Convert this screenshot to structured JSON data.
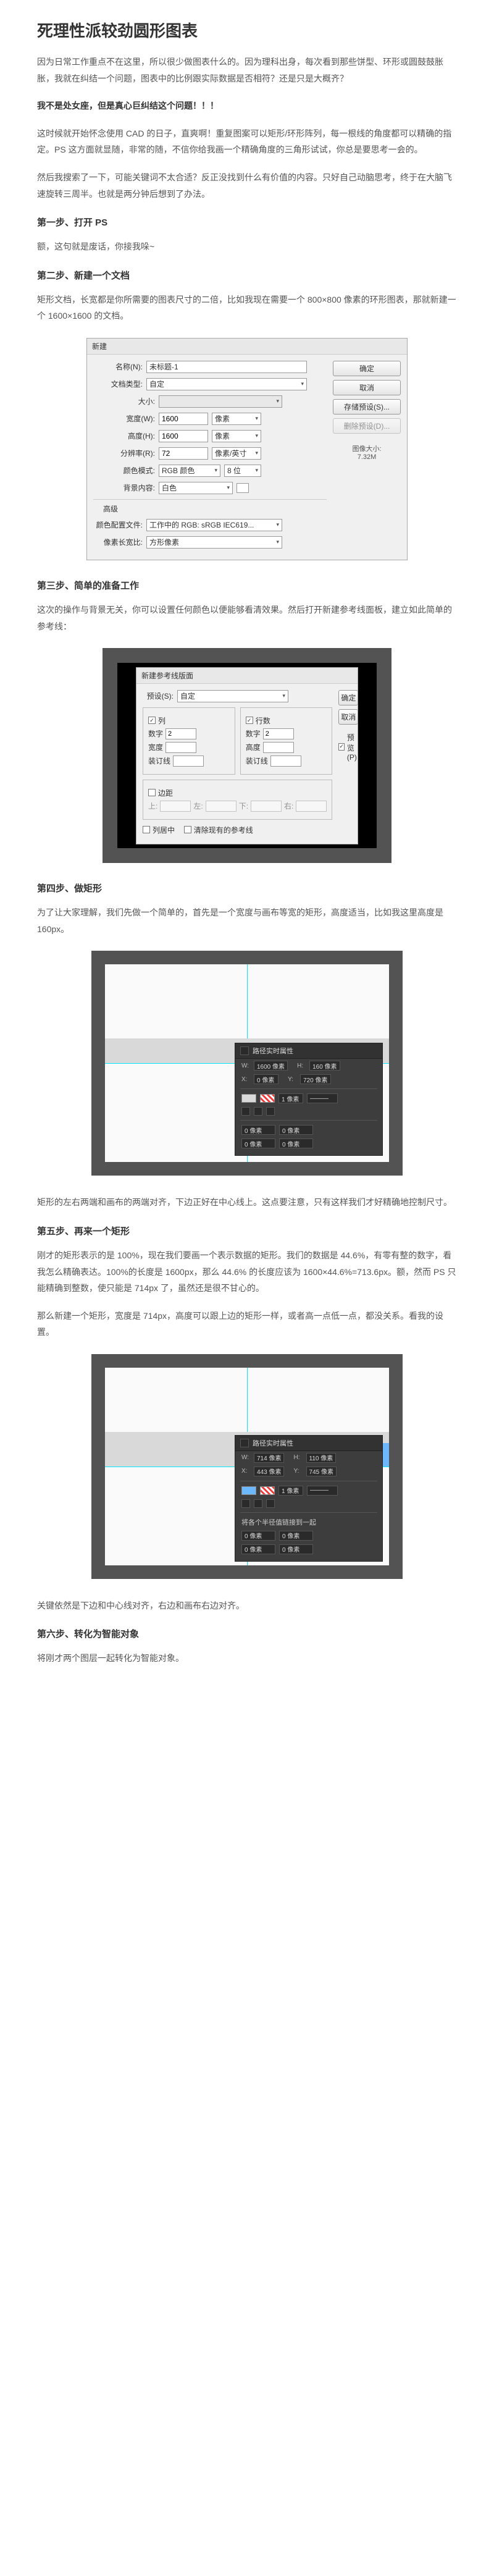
{
  "title": "死理性派较劲圆形图表",
  "intro1": "因为日常工作重点不在这里，所以很少做图表什么的。因为理科出身，每次看到那些饼型、环形或圆鼓鼓胀胀，我就在纠结一个问题，图表中的比例跟实际数据是否相符？还是只是大概齐？",
  "intro2_bold": "我不是处女座，但是真心巨纠结这个问题！！！",
  "intro3": "这时候就开始怀念使用 CAD 的日子，直爽啊！重复图案可以矩形/环形阵列，每一根线的角度都可以精确的指定。PS 这方面就显随，非常的随，不信你给我画一个精确角度的三角形试试，你总是要思考一会的。",
  "intro4": "然后我搜索了一下，可能关键词不太合适？反正没找到什么有价值的内容。只好自己动脑思考，终于在大脑飞速旋转三周半。也就是两分钟后想到了办法。",
  "step1_title": "第一步、打开 PS",
  "step1_text": "额，这句就是废话，你接我哚~",
  "step2_title": "第二步、新建一个文档",
  "step2_text": "矩形文档，长宽都是你所需要的图表尺寸的二倍，比如我现在需要一个 800×800 像素的环形图表，那就新建一个 1600×1600 的文档。",
  "newdoc": {
    "dlg_title": "新建",
    "name_lbl": "名称(N):",
    "name_val": "未标题-1",
    "preset_lbl": "文档类型:",
    "preset_val": "自定",
    "size_lbl": "大小:",
    "width_lbl": "宽度(W):",
    "width_val": "1600",
    "unit": "像素",
    "height_lbl": "高度(H):",
    "height_val": "1600",
    "res_lbl": "分辨率(R):",
    "res_val": "72",
    "res_unit": "像素/英寸",
    "mode_lbl": "颜色模式:",
    "mode_val": "RGB 颜色",
    "mode_bits": "8 位",
    "bg_lbl": "背景内容:",
    "bg_val": "白色",
    "adv_lbl": "高级",
    "profile_lbl": "颜色配置文件:",
    "profile_val": "工作中的 RGB: sRGB IEC619...",
    "aspect_lbl": "像素长宽比:",
    "aspect_val": "方形像素",
    "ok": "确定",
    "cancel": "取消",
    "save_preset": "存储预设(S)...",
    "del_preset": "删除预设(D)...",
    "imgsize_lbl": "图像大小:",
    "imgsize_val": "7.32M"
  },
  "step3_title": "第三步、简单的准备工作",
  "step3_text": "这次的操作与背景无关，你可以设置任何颜色以便能够看清效果。然后打开新建参考线面板，建立如此简单的参考线：",
  "guides": {
    "dlg_title": "新建参考线版面",
    "preset_lbl": "预设(S):",
    "preset_val": "自定",
    "col_lbl": "列",
    "row_lbl": "行数",
    "num_lbl": "数字",
    "gutter_lbl": "装订线",
    "width_lbl": "宽度",
    "height_lbl": "高度",
    "margin_lbl": "边距",
    "top_lbl": "上:",
    "left_lbl": "左:",
    "bottom_lbl": "下:",
    "right_lbl": "右:",
    "center_lbl": "列居中",
    "clear_lbl": "清除现有的参考线",
    "ok": "确定",
    "cancel": "取消",
    "preview": "预览(P)",
    "num_val": "2"
  },
  "step4_title": "第四步、做矩形",
  "step4_text": "为了让大家理解，我们先做一个简单的，首先是一个宽度与画布等宽的矩形，高度适当，比如我这里高度是 160px。",
  "props1": {
    "title": "路径实时属性",
    "w": "1600 像素",
    "h": "160 像素",
    "x": "0 像素",
    "y": "720 像素",
    "stroke_w": "1 像素",
    "fill_hex": "d9d9d9"
  },
  "step4_after": "矩形的左右两端和画布的两端对齐，下边正好在中心线上。这点要注意，只有这样我们才好精确地控制尺寸。",
  "step5_title": "第五步、再来一个矩形",
  "step5_p1": "刚才的矩形表示的是 100%，现在我们要画一个表示数据的矩形。我们的数据是 44.6%，有零有整的数字，看我怎么精确表达。100%的长度是 1600px，那么 44.6% 的长度应该为 1600×44.6%=713.6px。额，然而 PS 只能精确到整数，使只能是 714px 了，虽然还是很不甘心的。",
  "step5_p2": "那么新建一个矩形，宽度是 714px，高度可以跟上边的矩形一样，或者高一点低一点，都没关系。看我的设置。",
  "props2": {
    "title": "路径实时属性",
    "w": "714 像素",
    "h": "110 像素",
    "x": "443 像素",
    "y": "745 像素",
    "fill_hex": "6bb8ff",
    "note": "将各个半径值链接到一起"
  },
  "step5_after": "关键依然是下边和中心线对齐，右边和画布右边对齐。",
  "step6_title": "第六步、转化为智能对象",
  "step6_text": "将刚才两个图层一起转化为智能对象。"
}
